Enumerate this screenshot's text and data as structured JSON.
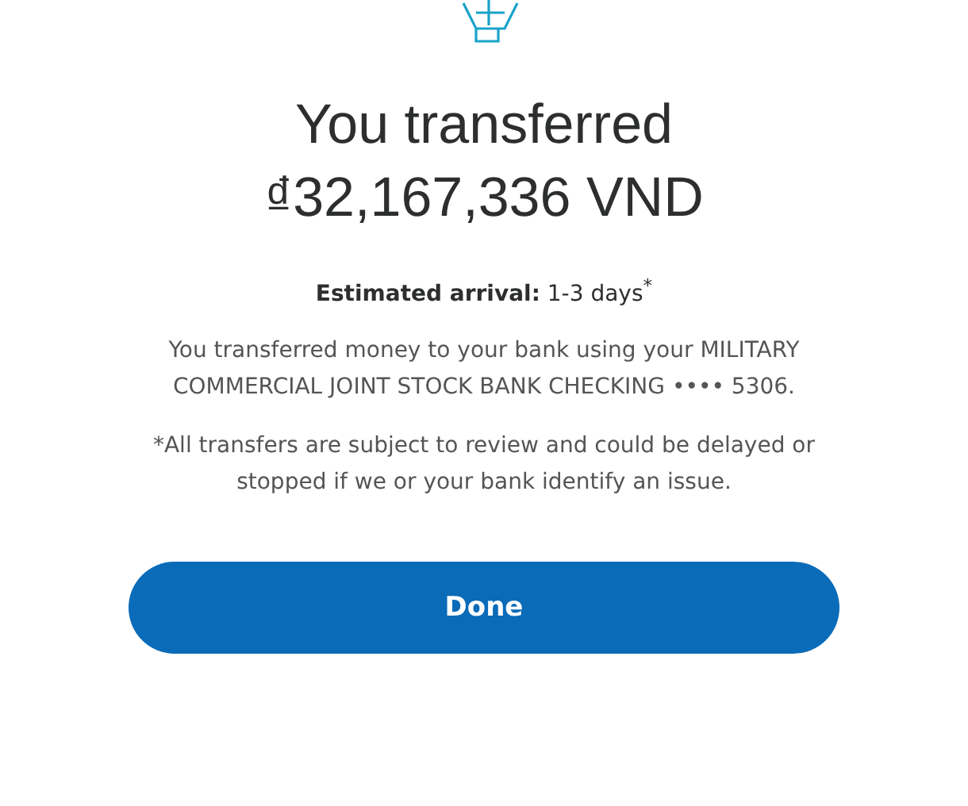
{
  "title_lines": [
    "You transferred",
    "₫32,167,336 VND"
  ],
  "arrival": "**Estimated arrival:** 1-3 days$^{*}$",
  "message": "You transferred money to your bank using your MILITARY COMMERCIAL JOINT STOCK BANK CHECKING •••• 5306.",
  "disclaimer": "*All transfers are subject to review and could be delayed or stopped if we or your bank identify an issue.",
  "button": "Done"
}
